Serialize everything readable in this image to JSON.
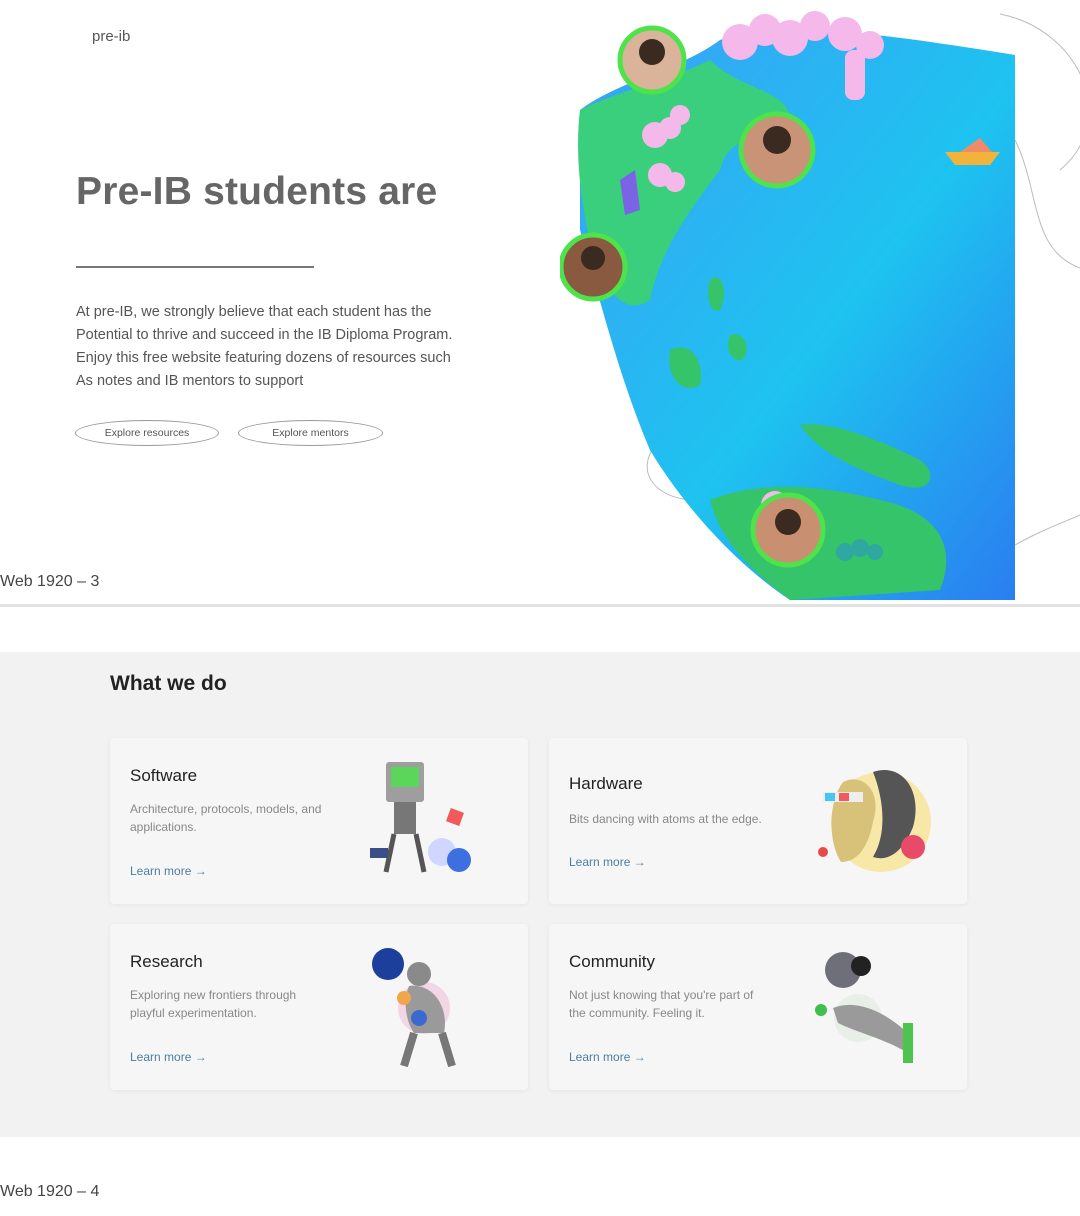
{
  "frame3": {
    "label": "Web 1920 – 3",
    "brand": "pre-ib",
    "hero_title": "Pre-IB students are",
    "hero_body": [
      "At pre-IB, we strongly believe that each student has the",
      "Potential to thrive and succeed in the IB Diploma Program.",
      "Enjoy this free website featuring dozens of resources such",
      "As notes and IB mentors to support"
    ],
    "buttons": {
      "resources": "Explore resources",
      "mentors": "Explore mentors"
    },
    "art_icon": "globe-illustration-with-avatars",
    "colors": {
      "globe_blue": "#1fb8ec",
      "land_green": "#3fd07a",
      "avatar_ring": "#4ee34a",
      "blossom_pink": "#f4b6e6"
    }
  },
  "frame4": {
    "label": "Web 1920 – 4",
    "section_title": "What we do",
    "cards": [
      {
        "title": "Software",
        "desc_lines": [
          "Architecture, protocols, models, and",
          "applications."
        ],
        "link": "Learn more",
        "icon": "retro-computer-figure"
      },
      {
        "title": "Hardware",
        "desc_lines": [
          "Bits dancing with atoms at the edge."
        ],
        "link": "Learn more",
        "icon": "3d-glasses-heads"
      },
      {
        "title": "Research",
        "desc_lines": [
          "Exploring new frontiers through",
          "playful experimentation."
        ],
        "link": "Learn more",
        "icon": "thinker-statue"
      },
      {
        "title": "Community",
        "desc_lines": [
          "Not just knowing that you're part of",
          "the community. Feeling it."
        ],
        "link": "Learn more",
        "icon": "hand-holding-planet"
      }
    ],
    "link_arrow": "→",
    "colors": {
      "link": "#4a7fa0",
      "background": "#f2f2f2"
    }
  }
}
